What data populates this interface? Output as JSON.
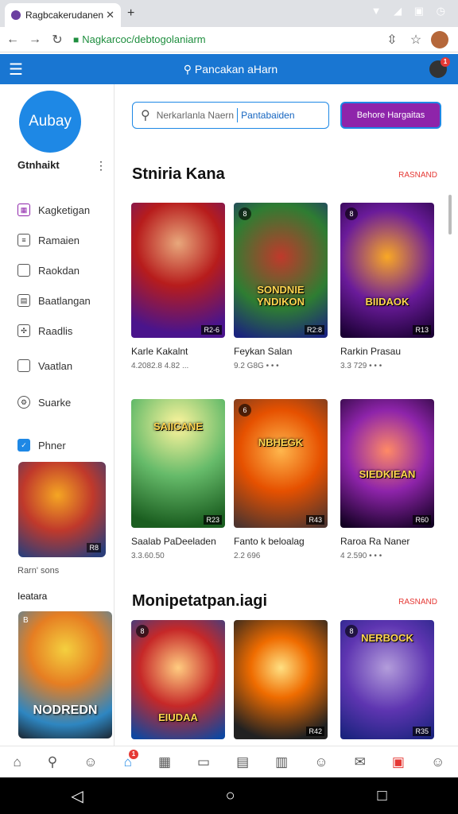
{
  "browser": {
    "tab_title": "Ragbcakerudanen",
    "url": "Nagkarcoc/debtogolaniarm",
    "status_icons": "▼ ◢ ▣ ◷"
  },
  "appbar": {
    "search_label": "Pancakan aHarn"
  },
  "sidebar": {
    "logo_text": "Aubay",
    "title": "Gtnhaikt",
    "items": [
      {
        "label": "Kagketigan",
        "icon": "calendar-icon"
      },
      {
        "label": "Ramaien",
        "icon": "list-icon"
      },
      {
        "label": "Raokdan",
        "icon": "document-icon"
      },
      {
        "label": "Baatlangan",
        "icon": "news-icon"
      },
      {
        "label": "Raadlis",
        "icon": "puzzle-icon"
      },
      {
        "label": "Vaatlan",
        "icon": "folder-icon"
      },
      {
        "label": "Suarke",
        "icon": "gear-icon"
      },
      {
        "label": "Phner",
        "icon": "check-icon"
      }
    ],
    "promo1_badge": "R8",
    "caption1": "Rarn' sons",
    "caption2": "Ieatara",
    "promo2_badge": "B",
    "promo2_text": "NODREDN"
  },
  "main": {
    "search_placeholder": "Nerkarlanla Naern",
    "search_value": "Pantabaiden",
    "cta_label": "Behore Hargaitas",
    "section1": {
      "title": "Stniria Kana",
      "more": "RASNAND",
      "cards": [
        {
          "name": "Karle Kakalnt",
          "meta": "4.2082.8 4.82 ...",
          "rating": "R2-6",
          "badge": "",
          "art": ""
        },
        {
          "name": "Feykan Salan",
          "meta": "9.2 G8G • • •",
          "rating": "R2:8",
          "badge": "8",
          "art": "SONDNIE YNDIKON"
        },
        {
          "name": "Rarkin Prasau",
          "meta": "3.3 729 • • •",
          "rating": "R13",
          "badge": "8",
          "art": "BIIDAOK"
        },
        {
          "name": "Saalab PaDeeladen",
          "meta": "3.3.60.50",
          "rating": "R23",
          "badge": "",
          "art": "SAIICANE"
        },
        {
          "name": "Fanto k beloalag",
          "meta": "2.2 696",
          "rating": "R43",
          "badge": "6",
          "art": "NBHEGK"
        },
        {
          "name": "Raroa Ra Naner",
          "meta": "4 2.590 • • •",
          "rating": "R60",
          "badge": "",
          "art": "SIEDKIEAN"
        }
      ]
    },
    "section2": {
      "title": "Monipetatpan.iagi",
      "more": "RASNAND",
      "cards": [
        {
          "rating": "",
          "badge": "8",
          "art": "EIUDAA"
        },
        {
          "rating": "R42",
          "badge": "",
          "art": ""
        },
        {
          "rating": "R35",
          "badge": "8",
          "art": "NERBOCK"
        }
      ]
    }
  },
  "colors": {
    "accent": "#1976d2",
    "cta": "#8e24aa",
    "more_link": "#e53935"
  }
}
